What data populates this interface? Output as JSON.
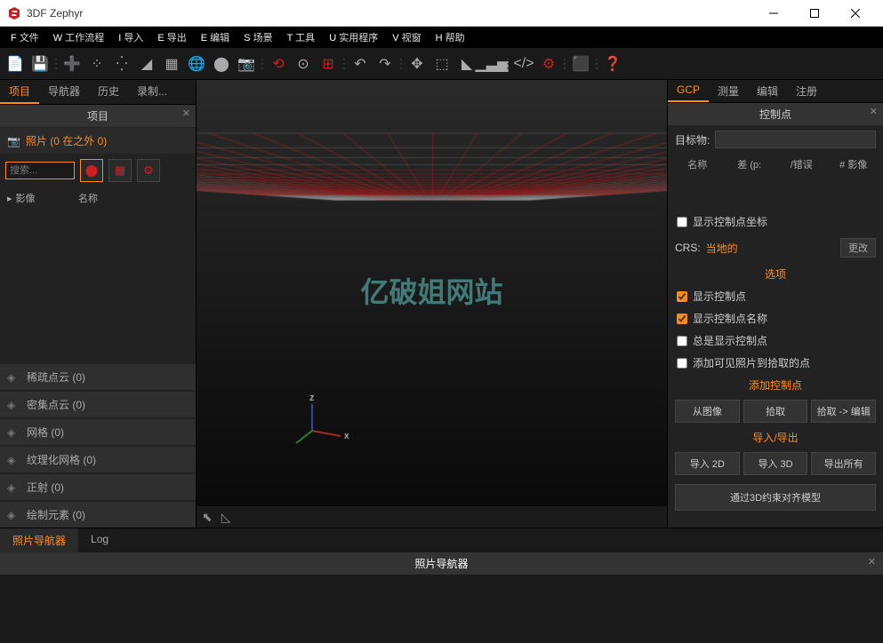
{
  "app": {
    "title": "3DF Zephyr"
  },
  "menu": [
    {
      "key": "F",
      "label": "文件"
    },
    {
      "key": "W",
      "label": "工作流程"
    },
    {
      "key": "I",
      "label": "导入"
    },
    {
      "key": "E",
      "label": "导出"
    },
    {
      "key": "E",
      "label": "编辑"
    },
    {
      "key": "S",
      "label": "场景"
    },
    {
      "key": "T",
      "label": "工具"
    },
    {
      "key": "U",
      "label": "实用程序"
    },
    {
      "key": "V",
      "label": "视窗"
    },
    {
      "key": "H",
      "label": "帮助"
    }
  ],
  "leftTabs": [
    "项目",
    "导航器",
    "历史",
    "录制..."
  ],
  "leftPanel": {
    "title": "项目",
    "photoLabel": "照片 (0 在之外 0)",
    "searchPlaceholder": "搜索...",
    "headers": {
      "col1": "影像",
      "col2": "名称"
    },
    "layers": [
      "稀疏点云 (0)",
      "密集点云 (0)",
      "网格 (0)",
      "纹理化网格 (0)",
      "正射 (0)",
      "绘制元素 (0)"
    ]
  },
  "viewport": {
    "watermark": "亿破姐网站",
    "axes": {
      "x": "x",
      "z": "z"
    }
  },
  "rightTabs": [
    "GCP",
    "测量",
    "编辑",
    "注册"
  ],
  "rightPanel": {
    "title": "控制点",
    "targetLabel": "目标物:",
    "columns": [
      "名称",
      "差 (p:",
      "/错误",
      "# 影像"
    ],
    "showCoords": "显示控制点坐标",
    "crsLabel": "CRS:",
    "crsValue": "当地的",
    "changeBtn": "更改",
    "optionsTitle": "选项",
    "options": [
      {
        "label": "显示控制点",
        "checked": true
      },
      {
        "label": "显示控制点名称",
        "checked": true
      },
      {
        "label": "总是显示控制点",
        "checked": false
      },
      {
        "label": "添加可见照片到拾取的点",
        "checked": false
      }
    ],
    "addTitle": "添加控制点",
    "addButtons": [
      "从图像",
      "拾取",
      "拾取 -> 编辑"
    ],
    "ioTitle": "导入/导出",
    "ioButtons": [
      "导入 2D",
      "导入 3D",
      "导出所有"
    ],
    "alignBtn": "通过3D约束对齐模型"
  },
  "bottomTabs": [
    "照片导航器",
    "Log"
  ],
  "bottomPanel": {
    "title": "照片导航器"
  }
}
